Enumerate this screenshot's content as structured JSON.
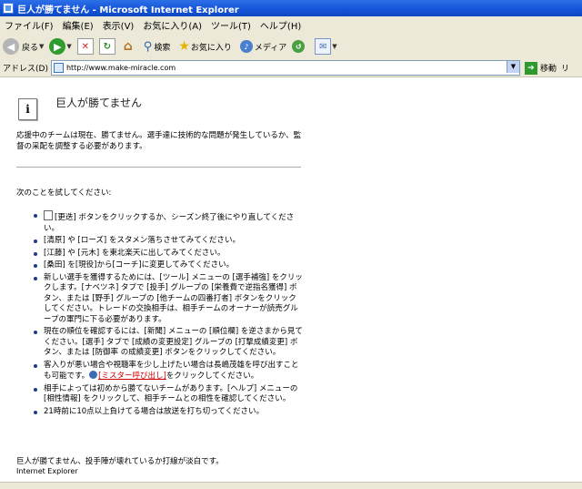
{
  "window": {
    "title": "巨人が勝てません - Microsoft Internet Explorer"
  },
  "menu": [
    "ファイル(F)",
    "編集(E)",
    "表示(V)",
    "お気に入り(A)",
    "ツール(T)",
    "ヘルプ(H)"
  ],
  "toolbar": {
    "back": "戻る",
    "search": "検索",
    "favorites": "お気に入り",
    "media": "メディア"
  },
  "address": {
    "label": "アドレス(D)",
    "url": "http://www.make-miracle.com",
    "go": "移動",
    "links": "リ"
  },
  "page": {
    "heading": "巨人が勝てません",
    "intro": "応援中のチームは現在、勝てません。選手達に技術的な問題が発生しているか、監督の采配を調整する必要があります。",
    "try": "次のことを試してください:",
    "tips": [
      "[更迭] ボタンをクリックするか、シーズン終了後にやり直してください。",
      "[清原] や [ローズ] をスタメン落ちさせてみてください。",
      "[江藤] や [元木] を東北楽天に出してみてください。",
      "[桑田] を[現役]から[コーチ]に変更してみてください。",
      "新しい選手を獲得するためには、[ツール] メニューの [選手補強] をクリックします。[ナベツネ] タブで [投手] グループの [栄養費で逆指名獲得] ボタン、または [野手] グループの [他チームの四番打者] ボタンをクリックしてください。トレードの交換相手は、相手チームのオーナーが読売グループの軍門に下る必要があります。",
      "現在の順位を確認するには、[新聞] メニューの [順位欄] を逆さまから見てください。[選手] タブで [成績の変更設定] グループの [打撃成績変更] ボタン、または [防御率 の成績変更] ボタンをクリックしてください。",
      "客入りが悪い場合や視聴率を少し上げたい場合は長嶋茂雄を呼び出すことも可能です。",
      "相手によっては初めから勝てないチームがあります。[ヘルプ] メニューの [相性情報] をクリックして、相手チームとの相性を確認してください。",
      "21時前に10点以上負けてる場合は放送を打ち切ってください。"
    ],
    "tip6_link": "[ミスター呼び出し]",
    "tip6_suffix": "をクリックしてください。",
    "footer_line1": "巨人が勝てません、投手陣が壊れているか打線が淡白です。",
    "footer_line2": "Internet Explorer"
  }
}
